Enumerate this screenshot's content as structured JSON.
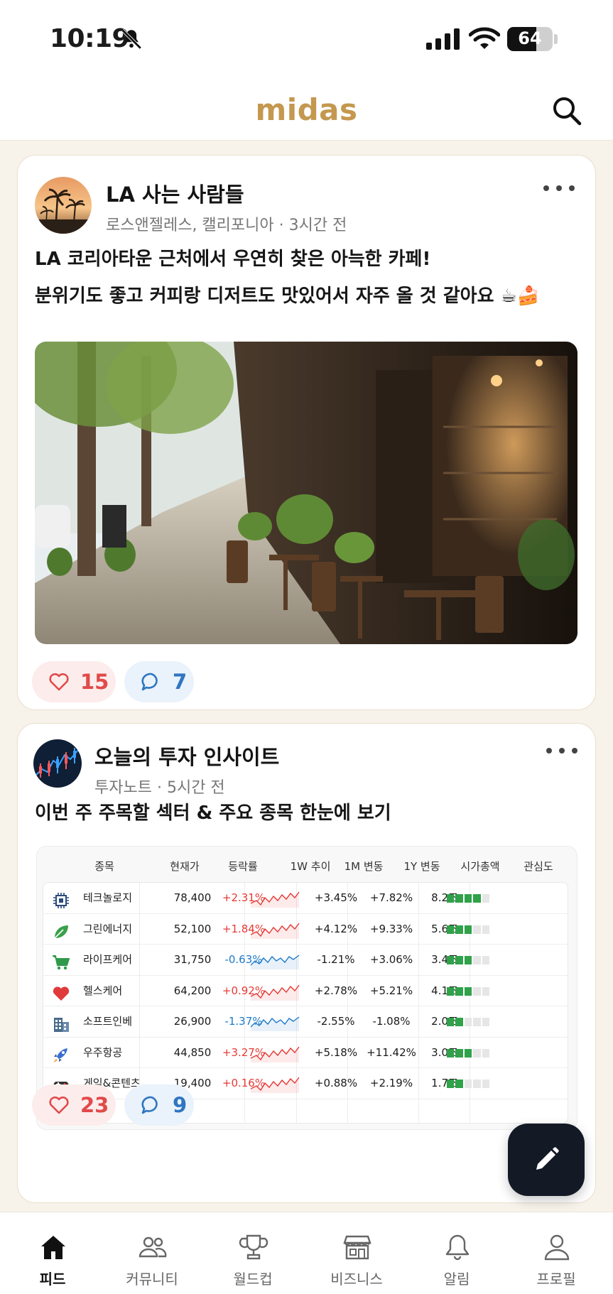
{
  "status": {
    "time": "10:19",
    "battery": "64",
    "battery_level": 0.64
  },
  "app": {
    "title": "midas"
  },
  "posts": [
    {
      "author": "LA 사는 사람들",
      "location": "로스앤젤레스, 캘리포니아",
      "time": "3시간 전",
      "text_line1": "LA 코리아타운 근처에서 우연히 찾은 아늑한 카페!",
      "text_line2": "분위기도 좋고 커피랑 디저트도 맛있어서 자주 올 것 같아요 ☕🍰",
      "likes": "15",
      "comments": "7"
    },
    {
      "author": "오늘의 투자 인사이트",
      "location": "투자노트",
      "time": "5시간 전",
      "title": "이번 주 주목할 섹터 & 주요 종목 한눈에 보기",
      "likes": "23",
      "comments": "9"
    }
  ],
  "meta_separator": " · ",
  "table": {
    "headers": [
      "종목",
      "현재가",
      "등락률",
      "1W 추이",
      "1M 변동",
      "1Y 변동",
      "시가총액",
      "관심도"
    ],
    "rows": [
      {
        "icon": "chip-icon",
        "name": "테크놀로지",
        "price": "78,400",
        "change": "+2.31%",
        "trend": "up",
        "m1": "+3.45%",
        "y1": "+7.82%",
        "cap": "8.2조",
        "interest": 4
      },
      {
        "icon": "leaf-icon",
        "name": "그린에너지",
        "price": "52,100",
        "change": "+1.84%",
        "trend": "up",
        "m1": "+4.12%",
        "y1": "+9.33%",
        "cap": "5.6조",
        "interest": 3
      },
      {
        "icon": "cart-icon",
        "name": "라이프케어",
        "price": "31,750",
        "change": "-0.63%",
        "trend": "down",
        "m1": "-1.21%",
        "y1": "+3.06%",
        "cap": "3.4조",
        "interest": 3
      },
      {
        "icon": "heart-icon",
        "name": "헬스케어",
        "price": "64,200",
        "change": "+0.92%",
        "trend": "up",
        "m1": "+2.78%",
        "y1": "+5.21%",
        "cap": "4.1조",
        "interest": 3
      },
      {
        "icon": "building-icon",
        "name": "소프트인베",
        "price": "26,900",
        "change": "-1.37%",
        "trend": "down",
        "m1": "-2.55%",
        "y1": "-1.08%",
        "cap": "2.0조",
        "interest": 2
      },
      {
        "icon": "rocket-icon",
        "name": "우주항공",
        "price": "44,850",
        "change": "+3.27%",
        "trend": "up",
        "m1": "+5.18%",
        "y1": "+11.42%",
        "cap": "3.0조",
        "interest": 3
      },
      {
        "icon": "gamepad-icon",
        "name": "게임&콘텐츠",
        "price": "19,400",
        "change": "+0.16%",
        "trend": "up",
        "m1": "+0.88%",
        "y1": "+2.19%",
        "cap": "1.7조",
        "interest": 2
      }
    ]
  },
  "tabs": [
    {
      "label": "피드",
      "icon": "home-icon",
      "active": true
    },
    {
      "label": "커뮤니티",
      "icon": "people-icon",
      "active": false
    },
    {
      "label": "월드컵",
      "icon": "trophy-icon",
      "active": false
    },
    {
      "label": "비즈니스",
      "icon": "store-icon",
      "active": false
    },
    {
      "label": "알림",
      "icon": "bell-icon",
      "active": false
    },
    {
      "label": "프로필",
      "icon": "profile-icon",
      "active": false
    }
  ],
  "colors": {
    "brand": "#c4984f",
    "up": "#e53935",
    "down": "#1e7ac8",
    "fab": "#131a26",
    "interest": "#2fa24a"
  }
}
